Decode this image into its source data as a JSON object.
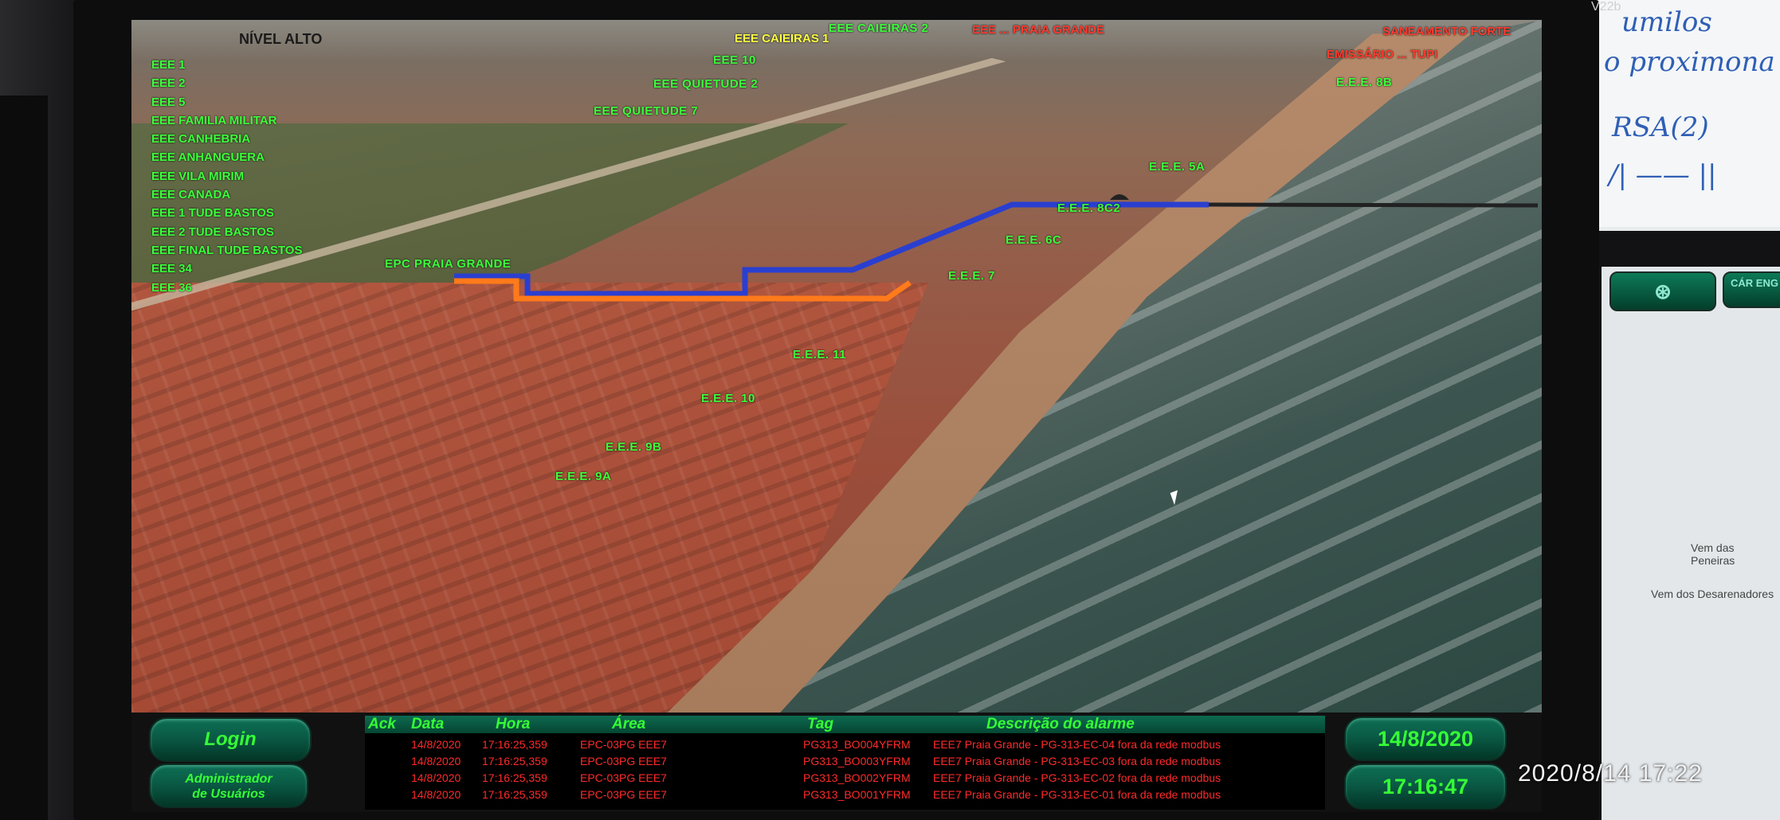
{
  "monitor": {
    "model": "V22b"
  },
  "photo_timestamp": "2020/8/14  17:22",
  "whiteboard": {
    "lines": [
      "umilos",
      "o proximona",
      "RSA(2)",
      "/| ——  ||"
    ]
  },
  "right_screen": {
    "buttons": [
      "",
      "CÁR ENG"
    ],
    "labels": [
      "Vem das Peneiras",
      "Vem dos Desarenadores"
    ]
  },
  "map": {
    "nivel_label": "NÍVEL ALTO",
    "station_list": [
      "EEE 1",
      "EEE 2",
      "EEE 5",
      "EEE FAMILIA MILITAR",
      "EEE CANHEBRIA",
      "EEE ANHANGUERA",
      "EEE VILA MIRIM",
      "EEE CANADA",
      "EEE 1 TUDE BASTOS",
      "EEE 2 TUDE BASTOS",
      "EEE FINAL TUDE BASTOS",
      "EEE 34",
      "EEE 36"
    ],
    "labels": {
      "caieiras1": "EEE CAIEIRAS 1",
      "caieiras2": "EEE CAIEIRAS 2",
      "eee10": "EEE 10",
      "quietude2": "EEE QUIETUDE 2",
      "quietude7": "EEE QUIETUDE 7",
      "red1": "EEE ... PRAIA GRANDE",
      "red2": "SANEAMENTO FORTE",
      "red3": "EMISSÁRIO ... TUPI",
      "eee8b": "E.E.E. 8B",
      "eee5a": "E.E.E. 5A",
      "eee8c": "E.E.E. 8C2",
      "eee6c": "E.E.E. 6C",
      "praia_grande": "EPC PRAIA GRANDE",
      "eee7": "E.E.E. 7",
      "eee11": "E.E.E. 11",
      "eee10b": "E.E.E. 10",
      "eee9b": "E.E.E. 9B",
      "eee9a": "E.E.E. 9A"
    }
  },
  "bottom_bar": {
    "login_label": "Login",
    "admin_label_1": "Administrador",
    "admin_label_2": "de Usuários",
    "date": "14/8/2020",
    "time": "17:16:47"
  },
  "alarm_table": {
    "headers": {
      "ack": "Ack",
      "data": "Data",
      "hora": "Hora",
      "area": "Área",
      "tag": "Tag",
      "descricao": "Descrição do alarme"
    },
    "rows": [
      {
        "data": "14/8/2020",
        "hora": "17:16:25,359",
        "area": "EPC-03PG EEE7",
        "tag": "PG313_BO004YFRM",
        "descricao": "EEE7 Praia Grande - PG-313-EC-04 fora da rede modbus"
      },
      {
        "data": "14/8/2020",
        "hora": "17:16:25,359",
        "area": "EPC-03PG EEE7",
        "tag": "PG313_BO003YFRM",
        "descricao": "EEE7 Praia Grande - PG-313-EC-03 fora da rede modbus"
      },
      {
        "data": "14/8/2020",
        "hora": "17:16:25,359",
        "area": "EPC-03PG EEE7",
        "tag": "PG313_BO002YFRM",
        "descricao": "EEE7 Praia Grande - PG-313-EC-02 fora da rede modbus"
      },
      {
        "data": "14/8/2020",
        "hora": "17:16:25,359",
        "area": "EPC-03PG EEE7",
        "tag": "PG313_BO001YFRM",
        "descricao": "EEE7 Praia Grande - PG-313-EC-01 fora da rede modbus"
      }
    ]
  },
  "colors": {
    "label_green": "#3cff3c",
    "alarm_red": "#ff2a2a",
    "pipe_blue": "#2a3fd0",
    "pipe_orange": "#ff7a1a",
    "button_green": "#0a5a45"
  }
}
